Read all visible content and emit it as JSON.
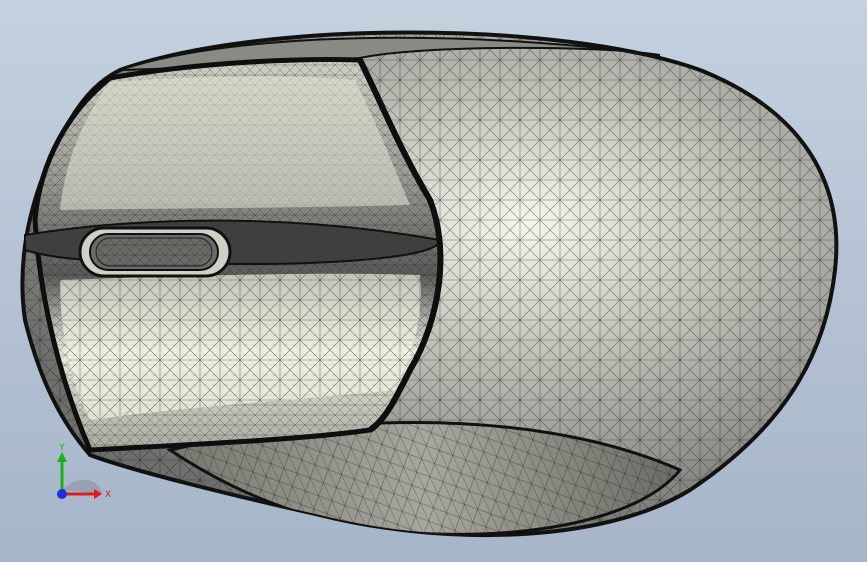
{
  "viewport": {
    "background_top": "#c4d1df",
    "background_bottom": "#a6b5c8"
  },
  "model": {
    "display_mode": "shaded-with-mesh-edges",
    "shell_color": "#9a9a96",
    "highlight_color": "#f4f5ea",
    "edge_color": "#1a1a1a"
  },
  "triad": {
    "y_label": "Y",
    "x_label": "X",
    "y_color": "#19b319",
    "x_color": "#e01b1b",
    "z_color": "#1b2fe0"
  }
}
